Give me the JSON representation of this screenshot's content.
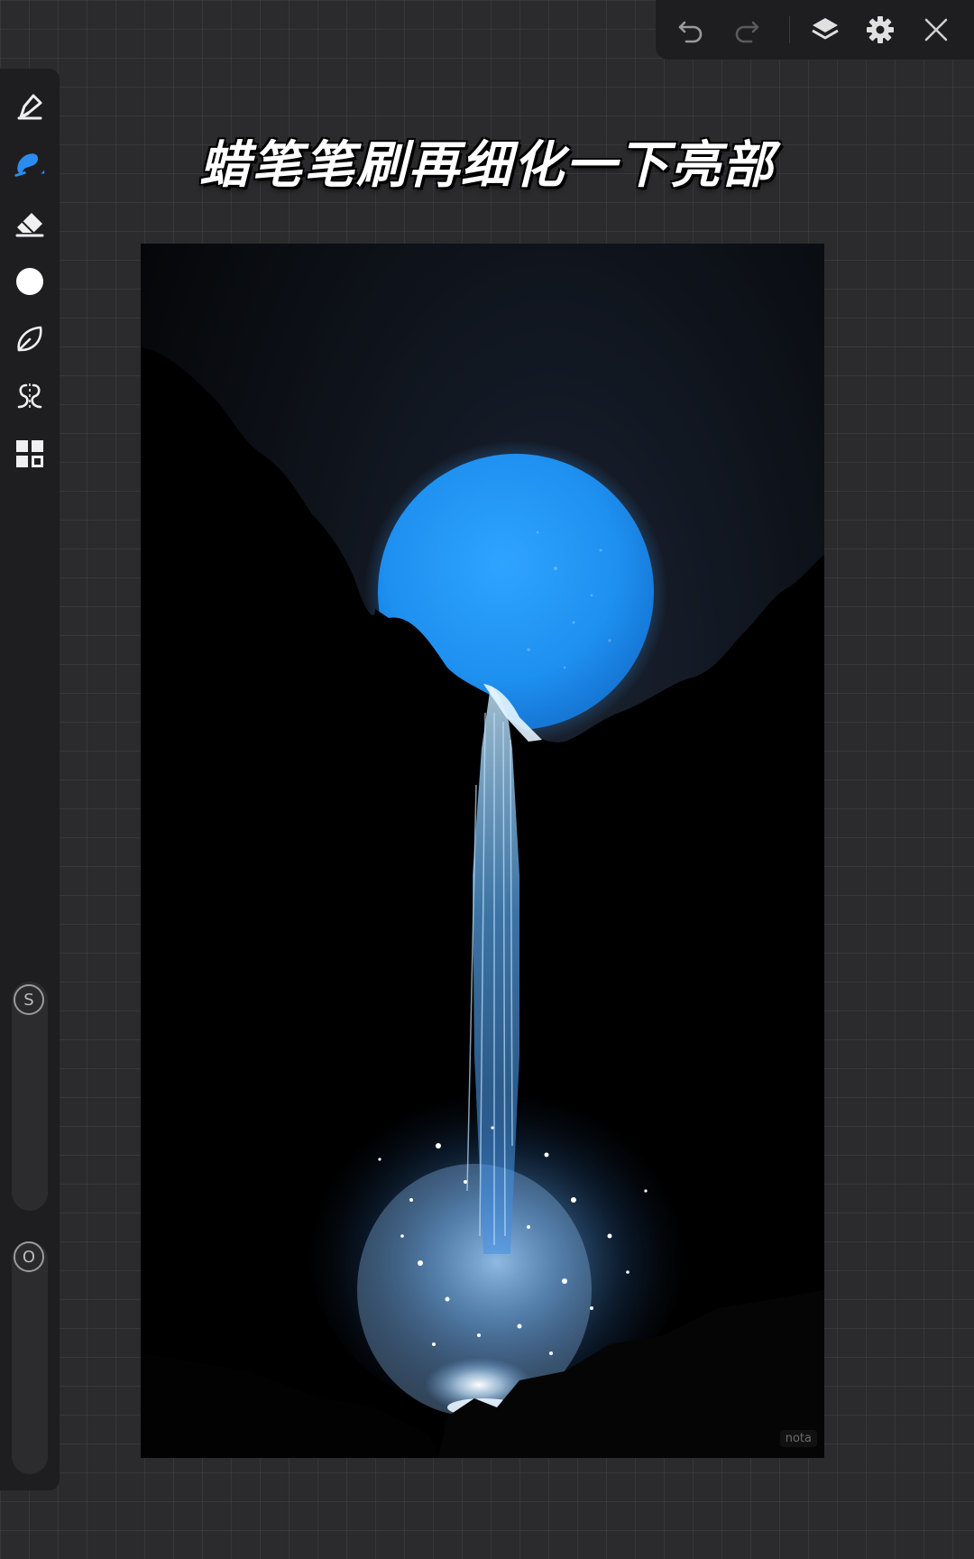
{
  "toolbar": {
    "icons": [
      "undo-icon",
      "redo-icon",
      "layers-icon",
      "settings-icon",
      "close-icon"
    ]
  },
  "sidebar": {
    "tools": [
      "pen-icon",
      "brush-icon",
      "eraser-icon",
      "color-icon",
      "lasso-icon",
      "symmetry-icon",
      "gallery-icon"
    ],
    "size_slider": {
      "label": "S"
    },
    "opacity_slider": {
      "label": "O"
    }
  },
  "caption": "蜡笔笔刷再细化一下亮部",
  "colors": {
    "moon": "#1e96f5",
    "accent": "#2a8cf0",
    "background": "#2b2b2d",
    "panel": "#1e1e20"
  },
  "watermark": "nota"
}
